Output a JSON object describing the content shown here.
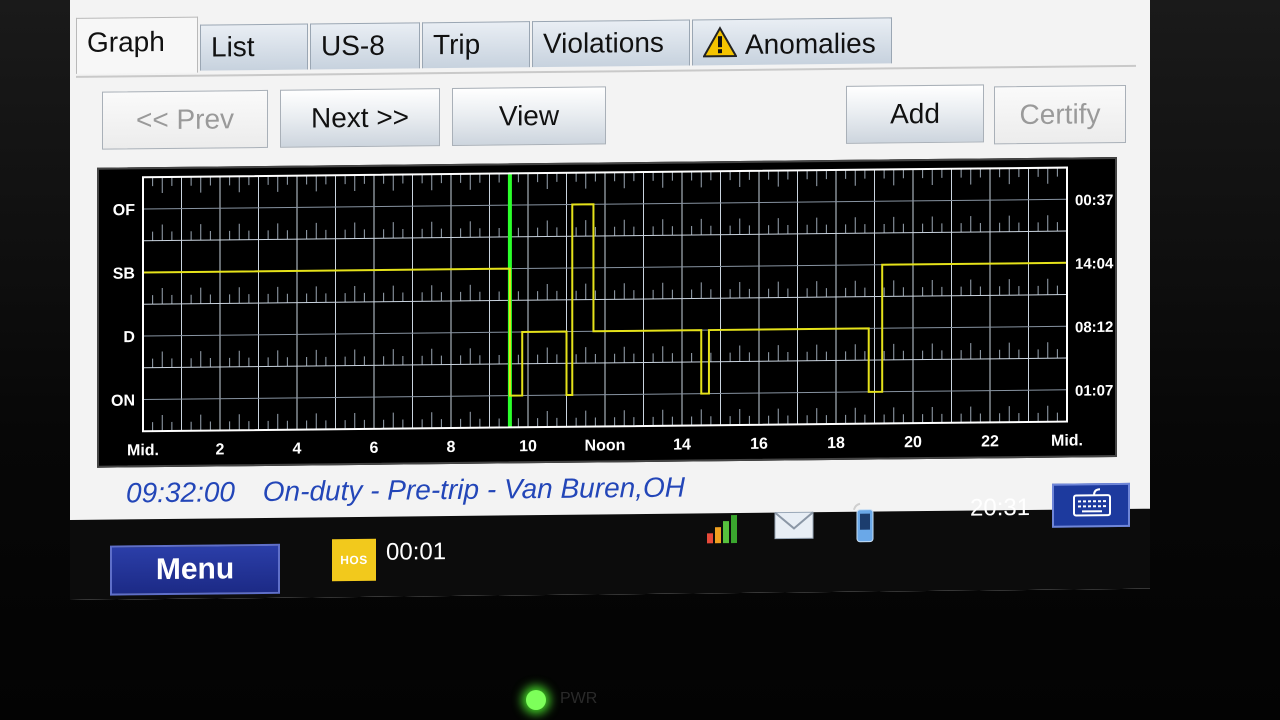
{
  "tabs": [
    {
      "label": "Graph",
      "active": true
    },
    {
      "label": "List",
      "active": false
    },
    {
      "label": "US-8",
      "active": false
    },
    {
      "label": "Trip",
      "active": false
    },
    {
      "label": "Violations",
      "active": false
    },
    {
      "label": "Anomalies",
      "active": false,
      "icon": "warning-icon"
    }
  ],
  "toolbar": {
    "prev_label": "<< Prev",
    "next_label": "Next >>",
    "view_label": "View",
    "add_label": "Add",
    "certify_label": "Certify"
  },
  "chart_data": {
    "type": "line",
    "x_unit": "hour of day",
    "xlim": [
      0,
      24
    ],
    "x_tick_labels": [
      "Mid.",
      "2",
      "4",
      "6",
      "8",
      "10",
      "Noon",
      "14",
      "16",
      "18",
      "20",
      "22",
      "Mid."
    ],
    "y_categories": [
      "OF",
      "SB",
      "D",
      "ON"
    ],
    "right_totals": [
      {
        "status": "OF",
        "value": "00:37"
      },
      {
        "status": "SB",
        "value": "14:04"
      },
      {
        "status": "D",
        "value": "08:12"
      },
      {
        "status": "ON",
        "value": "01:07"
      }
    ],
    "grid": true,
    "line_color": "#e5e21a",
    "marker_color": "#2bff2b",
    "current_time_marker": 9.53,
    "series": [
      {
        "points": [
          [
            0,
            "SB"
          ],
          [
            9.53,
            "SB"
          ],
          [
            9.53,
            "ON"
          ],
          [
            9.85,
            "ON"
          ],
          [
            9.85,
            "D"
          ],
          [
            11.0,
            "D"
          ],
          [
            11.0,
            "ON"
          ],
          [
            11.15,
            "ON"
          ],
          [
            11.15,
            "OF"
          ],
          [
            11.7,
            "OF"
          ],
          [
            11.7,
            "D"
          ],
          [
            14.5,
            "D"
          ],
          [
            14.5,
            "ON"
          ],
          [
            14.7,
            "ON"
          ],
          [
            14.7,
            "D"
          ],
          [
            18.85,
            "D"
          ],
          [
            18.85,
            "ON"
          ],
          [
            19.2,
            "ON"
          ],
          [
            19.2,
            "SB"
          ],
          [
            24,
            "SB"
          ]
        ]
      }
    ]
  },
  "status": {
    "time": "09:32:00",
    "description": "On-duty - Pre-trip - Van Buren,OH"
  },
  "taskbar": {
    "menu_label": "Menu",
    "hos_label": "HOS",
    "hos_timer": "00:01",
    "clock": "20:31",
    "signal_icon": "signal-bars-icon",
    "mail_icon": "mail-icon",
    "phone_icon": "phone-icon",
    "keyboard_icon": "keyboard-icon"
  },
  "device": {
    "pwr_label": "PWR"
  }
}
